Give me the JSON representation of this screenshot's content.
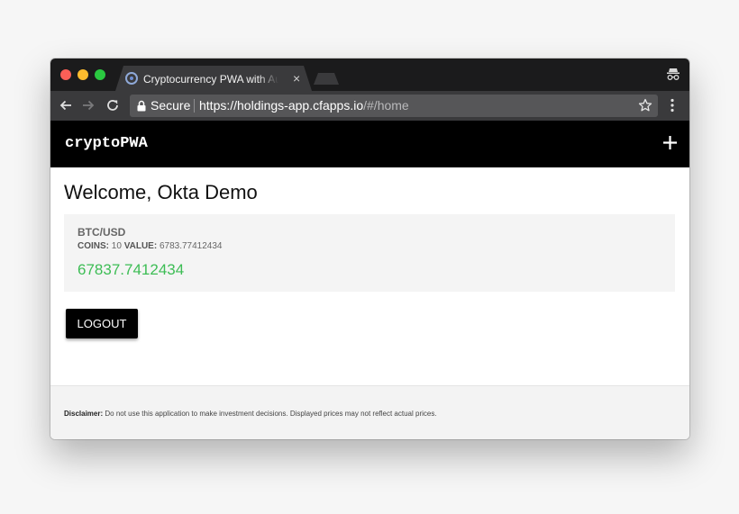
{
  "browser": {
    "tab_title": "Cryptocurrency PWA with Auth",
    "tab_close": "×",
    "secure_label": "Secure",
    "url_main": "https://holdings-app.cfapps.io",
    "url_path": "/#/home"
  },
  "app": {
    "brand": "cryptoPWA",
    "welcome": "Welcome, Okta Demo",
    "holding": {
      "pair": "BTC/USD",
      "coins_label": "COINS:",
      "coins": "10",
      "value_label": "VALUE:",
      "value": "6783.77412434",
      "total": "67837.7412434"
    },
    "logout_label": "LOGOUT"
  },
  "footer": {
    "disclaimer_label": "Disclaimer:",
    "disclaimer_text": "Do not use this application to make investment decisions. Displayed prices may not reflect actual prices."
  },
  "icons": {
    "favicon": "chrome-favicon",
    "incognito": "incognito-icon",
    "back": "arrow-left-icon",
    "forward": "arrow-right-icon",
    "reload": "reload-icon",
    "lock": "lock-icon",
    "star": "star-icon",
    "menu": "kebab-menu-icon",
    "add": "plus-icon"
  },
  "colors": {
    "app_bar": "#000000",
    "total_green": "#3dbd55",
    "browser_frame": "#1b1b1c",
    "toolbar": "#3a3a3c"
  }
}
